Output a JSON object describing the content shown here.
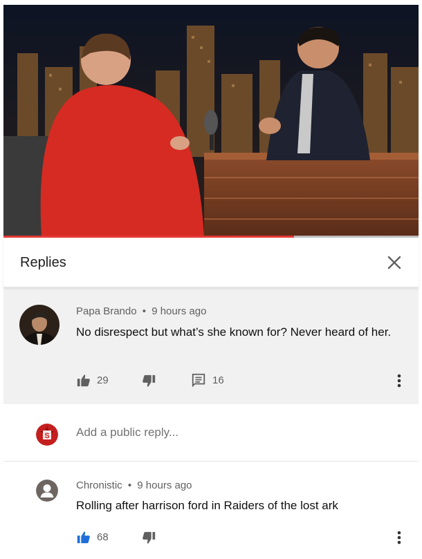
{
  "video": {
    "progress_fraction": 0.7
  },
  "replies_panel": {
    "title": "Replies",
    "close_icon": "close-icon"
  },
  "parent_comment": {
    "author": "Papa Brando",
    "separator": "•",
    "time": "9 hours ago",
    "text": "No disrespect but what’s she known for? Never heard of her.",
    "likes": "29",
    "replies": "16",
    "icons": [
      "thumbs-up-icon",
      "thumbs-down-icon",
      "comment-icon",
      "more-vert-icon"
    ]
  },
  "add_reply": {
    "placeholder": "Add a public reply...",
    "avatar_icon": "channel-avatar-icon"
  },
  "reply_comment": {
    "author": "Chronistic",
    "separator": "•",
    "time": "9 hours ago",
    "text": "Rolling after harrison ford in Raiders of the lost ark",
    "likes": "68",
    "icons": [
      "thumbs-up-icon",
      "thumbs-down-icon",
      "more-vert-icon"
    ]
  },
  "colors": {
    "progress_red": "#e53935",
    "liked_blue": "#1e6fd9",
    "parent_background": "#f1f1f1",
    "meta_gray": "#606060"
  }
}
